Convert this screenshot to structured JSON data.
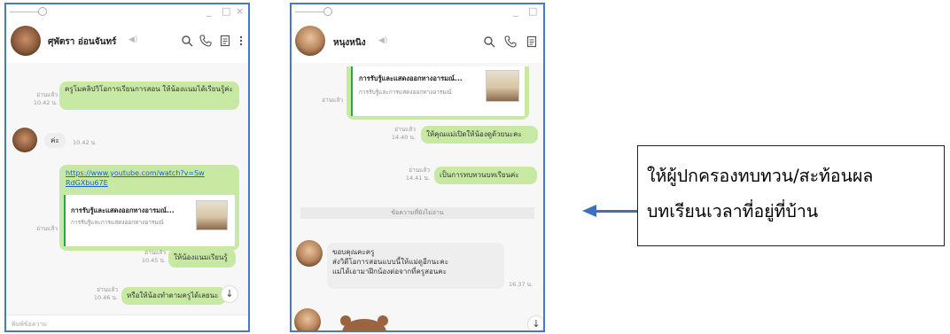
{
  "window1": {
    "contact_name": "ศุพัตรา อ่อนจันทร์",
    "window_buttons": [
      "_",
      "□",
      "×"
    ],
    "messages": [
      {
        "read": "อ่านแล้ว",
        "time": "10.42 น.",
        "text": "ครูโมคลิปวิโอการเรียนการสอน ให้น้องแนมได้เรียนรู้ค่ะ"
      },
      {
        "text": "ค่ะ",
        "time": "10.42 น."
      },
      {
        "link": "https://www.youtube.com/watch?v=SwRdGXbu67E",
        "card_title": "การรับรู้และแสดงออกทางอารมณ์...",
        "card_sub": "การรับรู้และการแสดงออกทางอารมณ์",
        "read": "อ่านแล้ว"
      },
      {
        "read": "อ่านแล้ว",
        "time": "10.45 น.",
        "text": "ให้น้องแนมเรียนรู้"
      },
      {
        "read": "อ่านแล้ว",
        "time": "10.46 น.",
        "text": "หรือให้น้องทำตามครูได้เลยนะ"
      }
    ],
    "input_placeholder": "พิมพ์ข้อความ",
    "scroll_glyph": "↓"
  },
  "window2": {
    "contact_name": "หนุงหนิง",
    "window_buttons": [
      "_",
      "□"
    ],
    "card_title": "การรับรู้และแสดงออกทางอารมณ์...",
    "card_sub": "การรับรู้และการแสดงออกทางอารมณ์",
    "card_read": "อ่านแล้ว",
    "messages": [
      {
        "read": "อ่านแล้ว",
        "time": "14.40 น.",
        "text": "ให้คุณแม่เปิดให้น้องดูด้วยนะคะ"
      },
      {
        "read": "อ่านแล้ว",
        "time": "14.41 น.",
        "text": "เป็นการทบทวนบทเรียนค่ะ"
      }
    ],
    "unread_divider": "ข้อความที่ยังไม่อ่าน",
    "reply": {
      "line1": "ขอบคุณคะครู",
      "line2": "ส่งวิดีโอการสอนแบบนี้ให้แม่ดูอีกนะคะ",
      "line3": "แม่ได้เอามาฝึกน้องต่อจากที่ครูสอนคะ",
      "time": "16.37 น."
    },
    "scroll_glyph": "↓"
  },
  "callout": {
    "line1": "ให้ผู้ปกครองทบทวน/สะท้อนผล",
    "line2": "บทเรียนเวลาที่อยู่ที่บ้าน"
  },
  "colors": {
    "window_border": "#4a78c8",
    "bubble_green": "#c8e9a3",
    "arrow": "#3c6fc2",
    "link": "#1a5fd0"
  }
}
